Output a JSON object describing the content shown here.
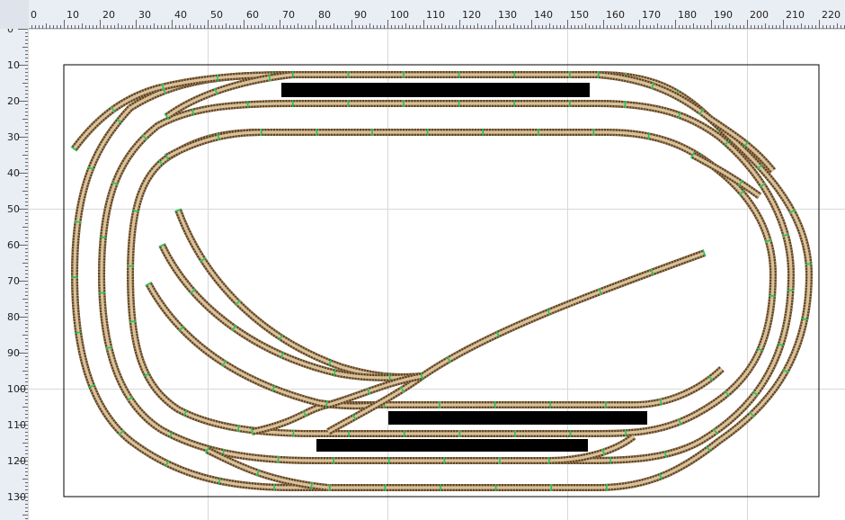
{
  "rulers": {
    "top_labels": [
      "0",
      "10",
      "20",
      "30",
      "40",
      "50",
      "60",
      "70",
      "80",
      "90",
      "100",
      "110",
      "120",
      "130",
      "140",
      "150",
      "160",
      "170",
      "180",
      "190",
      "200",
      "210",
      "220"
    ],
    "left_labels": [
      "0",
      "10",
      "20",
      "30",
      "40",
      "50",
      "60",
      "70",
      "80",
      "90",
      "100",
      "110",
      "120",
      "130"
    ]
  },
  "layout": {
    "baseboard": {
      "width": 210,
      "height": 120
    },
    "grid_step": 50
  },
  "colors": {
    "rail": "#5a4128",
    "sleeper": "#b08a58",
    "joint": "#22c45a",
    "platform": "#000000",
    "grid": "#d8d8d8",
    "ruler_bg": "#e9edf4"
  }
}
